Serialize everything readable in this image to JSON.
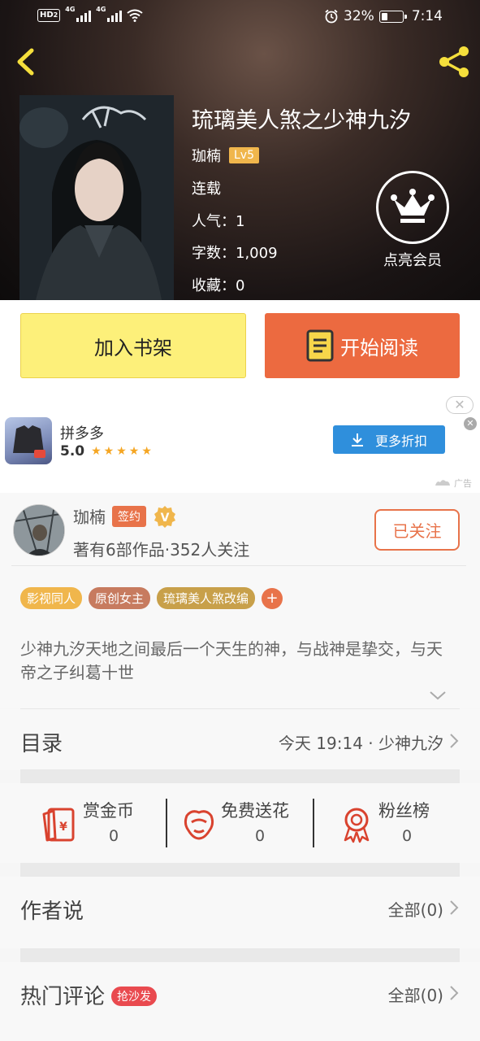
{
  "status_bar": {
    "hd_badge": "HD",
    "sim_num": "2",
    "net1": "4G",
    "net2": "4G",
    "battery_pct": "32%",
    "battery_level": 0.32,
    "time": "7:14"
  },
  "book": {
    "title": "琉璃美人煞之少神九汐",
    "author": "珈楠",
    "level": "Lv5",
    "status": "连载",
    "popularity_label": "人气：",
    "popularity": "1",
    "words_label": "字数：",
    "words": "1,009",
    "favorites_label": "收藏：",
    "favorites": "0"
  },
  "vip": {
    "label": "点亮会员"
  },
  "actions": {
    "add_shelf": "加入书架",
    "start_read": "开始阅读"
  },
  "ad": {
    "app_name": "拼多多",
    "rating": "5.0",
    "stars": "★★★★★",
    "button_label": "更多折扣",
    "close_oval": "✕",
    "close_x": "✕",
    "tag": "广告"
  },
  "author_card": {
    "name": "珈楠",
    "sign_badge": "签约",
    "v_badge": "V",
    "stats": "著有6部作品·352人关注",
    "follow_label": "已关注"
  },
  "tags": [
    {
      "label": "影视同人",
      "color": "#f0b64c"
    },
    {
      "label": "原创女主",
      "color": "#c77b5f"
    },
    {
      "label": "琉璃美人煞改编",
      "color": "#c8a04a"
    }
  ],
  "tag_add": "+",
  "description": "少神九汐天地之间最后一个天生的神，与战神是挚交，与天帝之子纠葛十世",
  "catalog": {
    "title": "目录",
    "latest": "今天 19:14 · 少神九汐"
  },
  "gifts": [
    {
      "label": "赏金币",
      "count": "0"
    },
    {
      "label": "免费送花",
      "count": "0"
    },
    {
      "label": "粉丝榜",
      "count": "0"
    }
  ],
  "author_says": {
    "title": "作者说",
    "right": "全部(0)"
  },
  "hot_comments": {
    "title": "热门评论",
    "badge": "抢沙发",
    "right": "全部(0)"
  },
  "colors": {
    "accent": "#e8734a",
    "shelf_btn": "#fdf07a",
    "read_btn": "#ec6a40",
    "ad_btn": "#2f8fdc",
    "gift_icon": "#d9432f"
  }
}
